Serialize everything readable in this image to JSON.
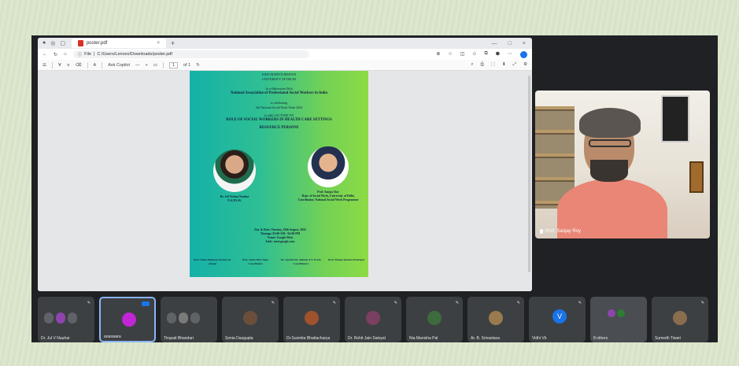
{
  "browser": {
    "tab_title": "poster.pdf",
    "tab_close": "×",
    "new_tab": "+",
    "window_controls": [
      "—",
      "□",
      "×"
    ],
    "url_prefix": "File",
    "url": "C:/Users/Lenovo/Downloads/poster.pdf",
    "pdf_toolbar": {
      "ask_copilot": "Ask Copilot",
      "zoom_minus": "—",
      "zoom_plus": "+",
      "page_current": "1",
      "page_total": "of 1"
    }
  },
  "poster": {
    "line1": "JOHN MARTIN BHAVAN",
    "line2": "UNIVERSITY OF DELHI",
    "collab": "In collaboration With",
    "assoc": "National Association of Professional Social Workers in India",
    "celebrating": "is celebrating",
    "day": "5th National Social Work Week 2024",
    "lecture": "(a talk) LECTURE ON",
    "topic": "ROLE OF SOCIAL WORKERS IN HEALTH CARE SETTINGS",
    "resource": "RESOURCE PERSONS",
    "speaker1": "Dr. Jul Vishnu Nauhar",
    "speaker1_org": "N.A.P.S.W.",
    "speaker2": "Prof. Sanjay Roy",
    "speaker2_org": "Dept. of Social Work, University of Delhi, Coordinator, National Social Work Programme",
    "event_date": "Day & Date: Tuesday, 20th August, 2024",
    "event_time": "Timings: 03:00 AM - 04:00 PM",
    "event_venue": "Venue: Google Meet",
    "event_link": "Link: meet.google.com",
    "footer": [
      "Prof. Smita Bahman  Section In-charge",
      "Prof. Smita Dutt  Dept. Coordinator",
      "Dr. Ajavuti  Dr. Ankush T.V.  Event Coordinators",
      "Prof. Manoj Sharma  Principal"
    ]
  },
  "speaker_tile": {
    "name": "Prof. Sanjay Roy"
  },
  "participants": [
    {
      "name": "Dr. Jul V Nauhar",
      "avatar_color": "#8e44ad"
    },
    {
      "name": "anaswara",
      "avatar_color": "#c026d3",
      "active": true
    },
    {
      "name": "Tirupati Bhandari",
      "avatar_color": "#7a7a7a"
    },
    {
      "name": "Sonia Dasgupta",
      "avatar_color": "#6b4f3a"
    },
    {
      "name": "Dr.Susmita Bhattacharya",
      "avatar_color": "#a0522d"
    },
    {
      "name": "Dr. Rohit Jain Sainyal",
      "avatar_color": "#7b3f61"
    },
    {
      "name": "Nia Manisha Pal",
      "avatar_color": "#3e6b3e"
    },
    {
      "name": "Ar. B. Srivastava",
      "avatar_color": "#9a7b4f"
    },
    {
      "name": "Vidhi Vb",
      "avatar_color": "#1a73e8",
      "letter": "V"
    },
    {
      "name": "8 others",
      "avatar_color": "#8e44ad"
    },
    {
      "name": "Sumedh Tiwari",
      "avatar_color": "#8a6d4f"
    }
  ]
}
